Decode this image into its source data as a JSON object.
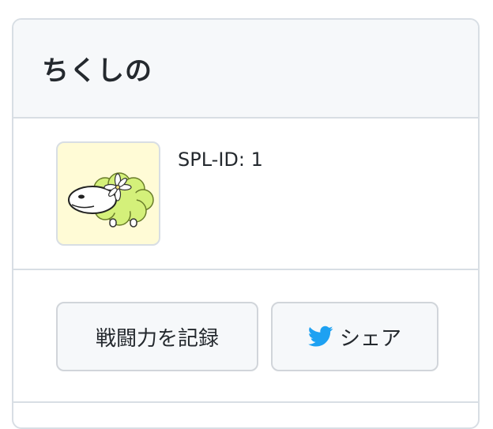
{
  "card": {
    "title": "ちくしの"
  },
  "profile": {
    "avatar_icon": "sheep-avatar-icon",
    "spl_id": "SPL-ID: 1"
  },
  "actions": {
    "record_label": "戦闘力を記録",
    "share_label": "シェア",
    "share_icon": "twitter-icon",
    "twitter_color": "#1da1f2"
  }
}
